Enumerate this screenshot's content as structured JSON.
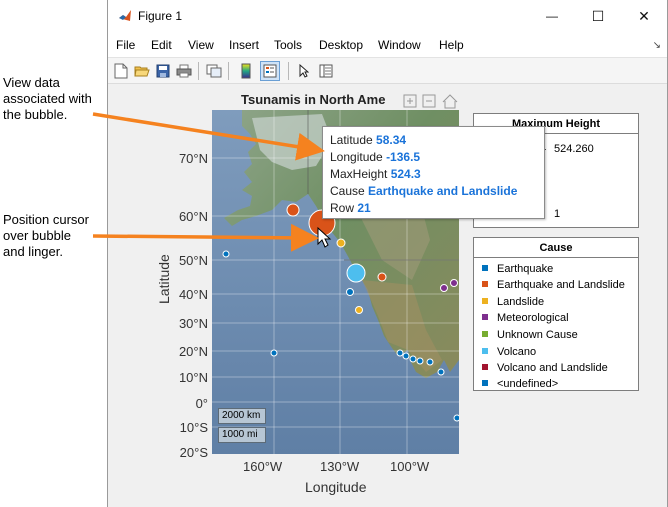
{
  "window": {
    "title": "Figure 1",
    "minimize": "—",
    "maximize": "☐",
    "close": "✕"
  },
  "menubar": {
    "items": [
      "File",
      "Edit",
      "View",
      "Insert",
      "Tools",
      "Desktop",
      "Window",
      "Help"
    ],
    "dock_arrow": "↘"
  },
  "toolbar": {
    "icons": [
      "new-figure-icon",
      "open-icon",
      "save-icon",
      "print-icon",
      "link-plot-icon",
      "colorbar-icon",
      "legend-icon",
      "pointer-icon",
      "property-inspector-icon"
    ]
  },
  "map": {
    "title": "Tsunamis in North Ame",
    "ylabel": "Latitude",
    "xlabel": "Longitude",
    "yticks": [
      "70°N",
      "60°N",
      "50°N",
      "40°N",
      "30°N",
      "20°N",
      "10°N",
      "0°",
      "10°S",
      "20°S"
    ],
    "xticks": [
      "160°W",
      "130°W",
      "100°W"
    ],
    "scale_km": "2000 km",
    "scale_mi": "1000 mi"
  },
  "max_height_panel": {
    "title": "Maximum Height",
    "value": "524.260",
    "size_value": "1"
  },
  "cause_panel": {
    "title": "Cause",
    "items": [
      {
        "label": "Earthquake",
        "color": "#0072bd"
      },
      {
        "label": "Earthquake and Landslide",
        "color": "#d95319"
      },
      {
        "label": "Landslide",
        "color": "#edb120"
      },
      {
        "label": "Meteorological",
        "color": "#7e2f8e"
      },
      {
        "label": "Unknown Cause",
        "color": "#77ac30"
      },
      {
        "label": "Volcano",
        "color": "#4dbeee"
      },
      {
        "label": "Volcano and Landslide",
        "color": "#a2142f"
      },
      {
        "label": "<undefined>",
        "color": "#0072bd"
      }
    ]
  },
  "datatip": {
    "latitude_label": "Latitude",
    "latitude_value": "58.34",
    "longitude_label": "Longitude",
    "longitude_value": "-136.5",
    "maxheight_label": "MaxHeight",
    "maxheight_value": "524.3",
    "cause_label": "Cause",
    "cause_value": "Earthquake and Landslide",
    "row_label": "Row",
    "row_value": "21"
  },
  "annotations": {
    "view_data": [
      "View data",
      "associated with",
      "the bubble."
    ],
    "position_cursor": [
      "Position cursor",
      "over bubble",
      "and linger."
    ]
  }
}
